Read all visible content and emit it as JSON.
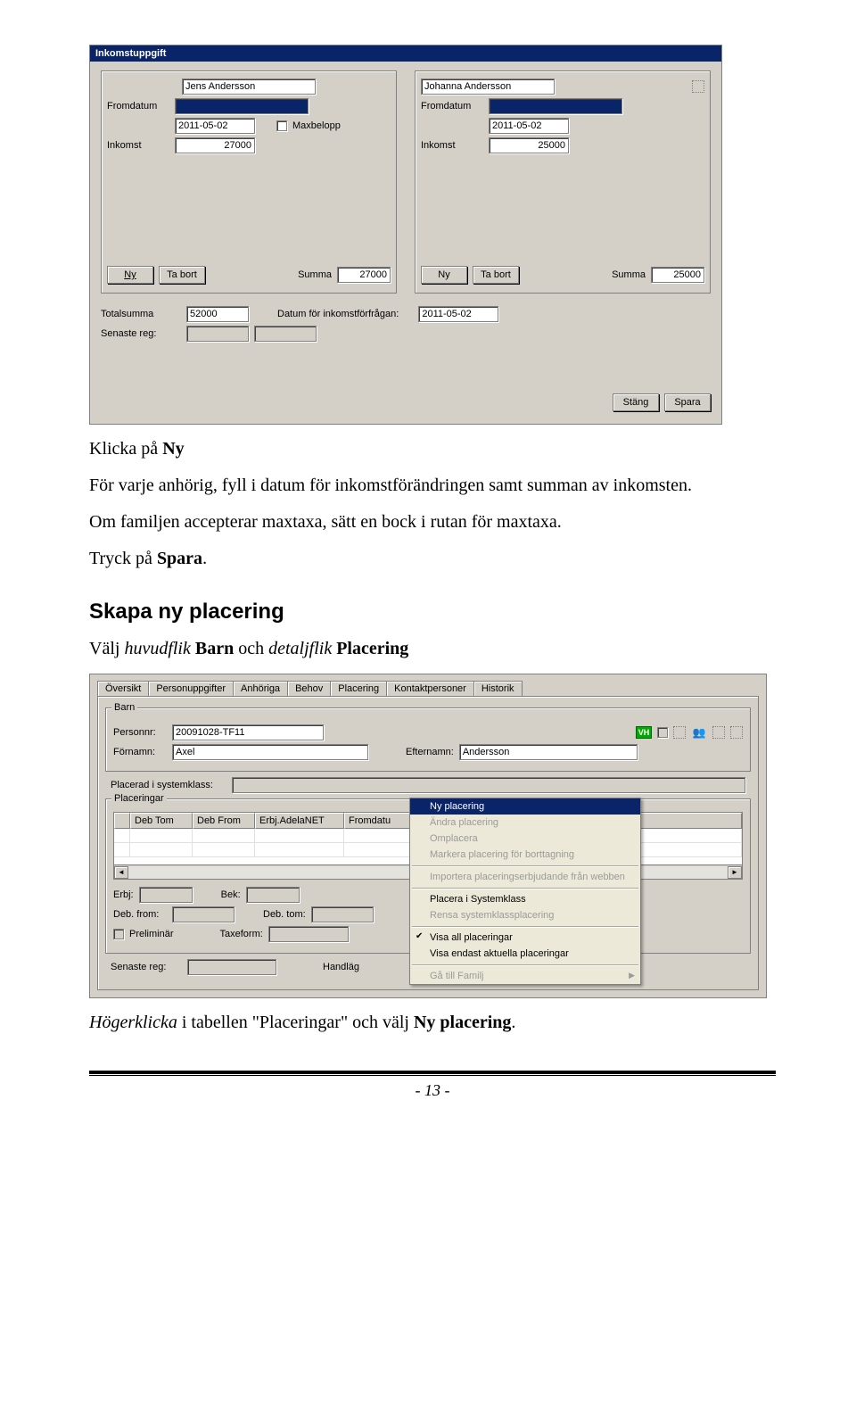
{
  "income_window": {
    "title": "Inkomstuppgift",
    "persons": [
      {
        "name": "Jens Andersson",
        "fromdatum_label": "Fromdatum",
        "fromdatum_value": "",
        "date": "2011-05-02",
        "maxbelopp_label": "Maxbelopp",
        "inkomst_label": "Inkomst",
        "inkomst_value": "27000",
        "ny_label": "Ny",
        "tabort_label": "Ta bort",
        "summa_label": "Summa",
        "summa_value": "27000"
      },
      {
        "name": "Johanna Andersson",
        "fromdatum_label": "Fromdatum",
        "fromdatum_value": "",
        "date": "2011-05-02",
        "maxbelopp_label": "",
        "inkomst_label": "Inkomst",
        "inkomst_value": "25000",
        "ny_label": "Ny",
        "tabort_label": "Ta bort",
        "summa_label": "Summa",
        "summa_value": "25000"
      }
    ],
    "totalsumma_label": "Totalsumma",
    "totalsumma_value": "52000",
    "datum_forfragan_label": "Datum för inkomstförfrågan:",
    "datum_forfragan_value": "2011-05-02",
    "senaste_reg_label": "Senaste reg:",
    "senaste_reg_value": "",
    "close_label": "Stäng",
    "save_label": "Spara"
  },
  "body": {
    "p1_a": "Klicka på ",
    "p1_b": "Ny",
    "p2": "För varje anhörig, fyll i datum för inkomstförändringen samt summan av inkomsten.",
    "p3": "Om familjen accepterar maxtaxa, sätt en bock i rutan för maxtaxa.",
    "p4_a": "Tryck på ",
    "p4_b": "Spara",
    "p4_c": ".",
    "h2": "Skapa ny placering",
    "p5_a": "Välj ",
    "p5_b": "huvudflik",
    "p5_c": " Barn",
    "p5_d": " och ",
    "p5_e": "detaljflik",
    "p5_f": " Placering",
    "p6_a": "Högerklicka",
    "p6_b": " i tabellen \"Placeringar\" och välj ",
    "p6_c": "Ny placering",
    "p6_d": "."
  },
  "placering_window": {
    "tabs": [
      "Översikt",
      "Personuppgifter",
      "Anhöriga",
      "Behov",
      "Placering",
      "Kontaktpersoner",
      "Historik"
    ],
    "active_tab_index": 4,
    "barn": {
      "legend": "Barn",
      "personnr_label": "Personnr:",
      "personnr_value": "20091028-TF11",
      "fornamn_label": "Förnamn:",
      "fornamn_value": "Axel",
      "efternamn_label": "Efternamn:",
      "efternamn_value": "Andersson",
      "vh_label": "VH"
    },
    "sysklass_label": "Placerad i systemklass:",
    "sysklass_value": "",
    "placeringar": {
      "legend": "Placeringar",
      "columns": [
        "",
        "Deb Tom",
        "Deb From",
        "Erbj.AdelaNET",
        "Fromdatu"
      ],
      "erbj_label": "Erbj:",
      "bek_label": "Bek:",
      "debfrom_label": "Deb. from:",
      "debtom_label": "Deb. tom:",
      "preliminar_label": "Preliminär",
      "taxeform_label": "Taxeform:",
      "senaste_reg_label": "Senaste reg:",
      "handlag_label": "Handläg"
    },
    "context_menu": [
      {
        "label": "Ny placering",
        "state": "selected"
      },
      {
        "label": "Ändra placering",
        "state": "disabled"
      },
      {
        "label": "Omplacera",
        "state": "disabled"
      },
      {
        "label": "Markera placering för borttagning",
        "state": "disabled"
      },
      {
        "sep": true
      },
      {
        "label": "Importera placeringserbjudande från webben",
        "state": "disabled"
      },
      {
        "sep": true
      },
      {
        "label": "Placera i Systemklass",
        "state": "normal"
      },
      {
        "label": "Rensa systemklassplacering",
        "state": "disabled"
      },
      {
        "sep": true
      },
      {
        "label": "Visa all placeringar",
        "state": "normal",
        "checked": true
      },
      {
        "label": "Visa endast aktuella placeringar",
        "state": "normal"
      },
      {
        "sep": true
      },
      {
        "label": "Gå till Familj",
        "state": "disabled",
        "submenu": true
      }
    ]
  },
  "page_number": "- 13 -"
}
